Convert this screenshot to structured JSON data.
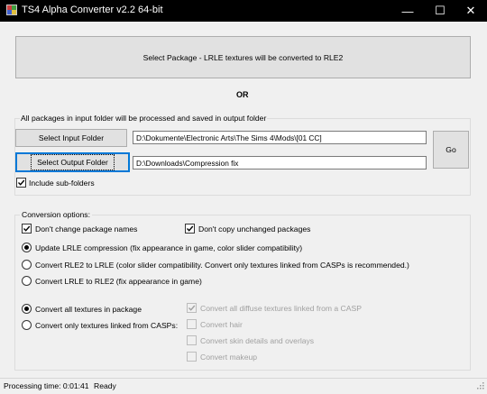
{
  "window": {
    "title": "TS4 Alpha Converter v2.2 64-bit",
    "minimize": "—",
    "maximize": "☐",
    "close": "✕"
  },
  "main": {
    "select_package_button": "Select Package - LRLE textures will be converted to RLE2",
    "or_label": "OR"
  },
  "folders": {
    "caption": "All packages in input folder will be processed and saved in output folder",
    "select_input_button": "Select Input Folder",
    "input_path": "D:\\Dokumente\\Electronic Arts\\The Sims 4\\Mods\\[01 CC]",
    "select_output_button": "Select Output Folder",
    "output_path": "D:\\Downloads\\Compression fix",
    "go_button": "Go",
    "include_subfolders": {
      "label": "Include sub-folders",
      "checked": true
    }
  },
  "options": {
    "title": "Conversion options:",
    "dont_change_names": {
      "label": "Don't change package names",
      "checked": true
    },
    "dont_copy_unchanged": {
      "label": "Don't copy unchanged packages",
      "checked": true
    },
    "compression_modes": [
      {
        "label": "Update LRLE compression (fix appearance in game, color slider compatibility)",
        "selected": true
      },
      {
        "label": "Convert RLE2 to LRLE (color slider compatibility. Convert only textures linked from CASPs is recommended.)",
        "selected": false
      },
      {
        "label": "Convert LRLE to RLE2 (fix appearance in game)",
        "selected": false
      }
    ],
    "scope_modes": [
      {
        "label": "Convert all textures in package",
        "selected": true
      },
      {
        "label": "Convert only textures linked from CASPs:",
        "selected": false
      }
    ],
    "casp_options": [
      {
        "label": "Convert all diffuse textures linked from a CASP",
        "checked": true
      },
      {
        "label": "Convert hair",
        "checked": false
      },
      {
        "label": "Convert skin details and overlays",
        "checked": false
      },
      {
        "label": "Convert makeup",
        "checked": false
      }
    ]
  },
  "status": {
    "processing_time": "Processing time: 0:01:41",
    "state": "Ready"
  }
}
